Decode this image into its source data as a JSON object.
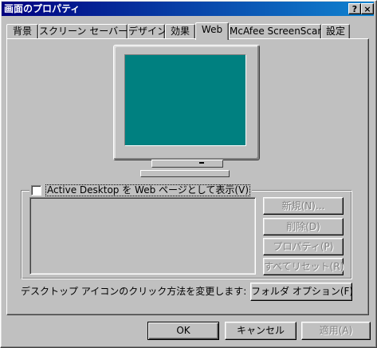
{
  "window": {
    "title": "画面のプロパティ",
    "help_label": "?",
    "close_label": "×"
  },
  "tabs": [
    {
      "label": "背景"
    },
    {
      "label": "スクリーン セーバー"
    },
    {
      "label": "デザイン"
    },
    {
      "label": "効果"
    },
    {
      "label": "Web"
    },
    {
      "label": "McAfee ScreenScan"
    },
    {
      "label": "設定"
    }
  ],
  "active_tab": "Web",
  "monitor": {
    "screen_color": "#008080"
  },
  "active_desktop": {
    "checkbox_label": "Active Desktop を Web ページとして表示(V)",
    "checked": false
  },
  "side_buttons": [
    {
      "label": "新規(N)...",
      "enabled": false
    },
    {
      "label": "削除(D)",
      "enabled": false
    },
    {
      "label": "プロパティ(P)",
      "enabled": false
    },
    {
      "label": "すべてリセット(R)",
      "enabled": false
    }
  ],
  "icon_click": {
    "text": "デスクトップ アイコンのクリック方法を変更します:",
    "button_label": "フォルダ オプション(F)"
  },
  "dialog_buttons": {
    "ok": "OK",
    "cancel": "キャンセル",
    "apply": "適用(A)"
  },
  "colors": {
    "titlebar_start": "#000080",
    "titlebar_end": "#1084d0",
    "face": "#c0c0c0"
  }
}
